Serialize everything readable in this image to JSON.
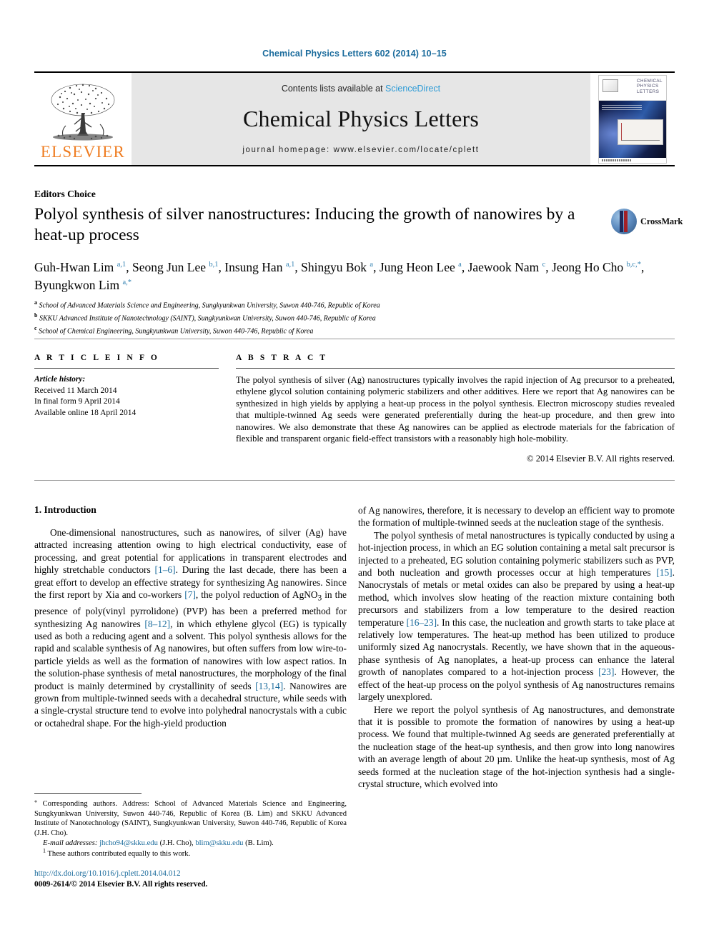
{
  "running_head": "Chemical Physics Letters 602 (2014) 10–15",
  "masthead": {
    "publisher_logo_text": "ELSEVIER",
    "contents_prefix": "Contents lists available at ",
    "sciencedirect": "ScienceDirect",
    "journal_title": "Chemical Physics Letters",
    "homepage_line": "journal homepage: www.elsevier.com/locate/cplett",
    "cover_title_lines": [
      "CHEMICAL",
      "PHYSICS",
      "LETTERS"
    ]
  },
  "article": {
    "category": "Editors Choice",
    "crossmark_label": "CrossMark",
    "title": "Polyol synthesis of silver nanostructures: Inducing the growth of nanowires by a heat-up process",
    "authors_html": "Guh-Hwan Lim <sup>a,1</sup>, Seong Jun Lee <sup>b,1</sup>, Insung Han <sup>a,1</sup>, Shingyu Bok <sup>a</sup>, Jung Heon Lee <sup>a</sup>, Jaewook Nam <sup>c</sup>, Jeong Ho Cho <sup>b,c,</sup><sup>*</sup>, Byungkwon Lim <sup>a,</sup><sup>*</sup>",
    "affiliations": [
      {
        "marker": "a",
        "text": "School of Advanced Materials Science and Engineering, Sungkyunkwan University, Suwon 440-746, Republic of Korea"
      },
      {
        "marker": "b",
        "text": "SKKU Advanced Institute of Nanotechnology (SAINT), Sungkyunkwan University, Suwon 440-746, Republic of Korea"
      },
      {
        "marker": "c",
        "text": "School of Chemical Engineering, Sungkyunkwan University, Suwon 440-746, Republic of Korea"
      }
    ]
  },
  "article_info": {
    "label": "A R T I C L E    I N F O",
    "history_label": "Article history:",
    "history": [
      "Received 11 March 2014",
      "In final form 9 April 2014",
      "Available online 18 April 2014"
    ]
  },
  "abstract": {
    "label": "A B S T R A C T",
    "text": "The polyol synthesis of silver (Ag) nanostructures typically involves the rapid injection of Ag precursor to a preheated, ethylene glycol solution containing polymeric stabilizers and other additives. Here we report that Ag nanowires can be synthesized in high yields by applying a heat-up process in the polyol synthesis. Electron microscopy studies revealed that multiple-twinned Ag seeds were generated preferentially during the heat-up procedure, and then grew into nanowires. We also demonstrate that these Ag nanowires can be applied as electrode materials for the fabrication of flexible and transparent organic field-effect transistors with a reasonably high hole-mobility.",
    "copyright": "© 2014 Elsevier B.V. All rights reserved."
  },
  "body": {
    "section_heading": "1. Introduction",
    "left_paragraphs_html": [
      "One-dimensional nanostructures, such as nanowires, of silver (Ag) have attracted increasing attention owing to high electrical conductivity, ease of processing, and great potential for applications in transparent electrodes and highly stretchable conductors <span class=\"ref\">[1–6]</span>. During the last decade, there has been a great effort to develop an effective strategy for synthesizing Ag nanowires. Since the first report by Xia and co-workers <span class=\"ref\">[7]</span>, the polyol reduction of AgNO<sub>3</sub> in the presence of poly(vinyl pyrrolidone) (PVP) has been a preferred method for synthesizing Ag nanowires <span class=\"ref\">[8–12]</span>, in which ethylene glycol (EG) is typically used as both a reducing agent and a solvent. This polyol synthesis allows for the rapid and scalable synthesis of Ag nanowires, but often suffers from low wire-to-particle yields as well as the formation of nanowires with low aspect ratios. In the solution-phase synthesis of metal nanostructures, the morphology of the final product is mainly determined by crystallinity of seeds <span class=\"ref\">[13,14]</span>. Nanowires are grown from multiple-twinned seeds with a decahedral structure, while seeds with a single-crystal structure tend to evolve into polyhedral nanocrystals with a cubic or octahedral shape. For the high-yield production"
    ],
    "right_paragraphs_html": [
      "of Ag nanowires, therefore, it is necessary to develop an efficient way to promote the formation of multiple-twinned seeds at the nucleation stage of the synthesis.",
      "The polyol synthesis of metal nanostructures is typically conducted by using a hot-injection process, in which an EG solution containing a metal salt precursor is injected to a preheated, EG solution containing polymeric stabilizers such as PVP, and both nucleation and growth processes occur at high temperatures <span class=\"ref\">[15]</span>. Nanocrystals of metals or metal oxides can also be prepared by using a heat-up method, which involves slow heating of the reaction mixture containing both precursors and stabilizers from a low temperature to the desired reaction temperature <span class=\"ref\">[16–23]</span>. In this case, the nucleation and growth starts to take place at relatively low temperatures. The heat-up method has been utilized to produce uniformly sized Ag nanocrystals. Recently, we have shown that in the aqueous-phase synthesis of Ag nanoplates, a heat-up process can enhance the lateral growth of nanoplates compared to a hot-injection process <span class=\"ref\">[23]</span>. However, the effect of the heat-up process on the polyol synthesis of Ag nanostructures remains largely unexplored.",
      "Here we report the polyol synthesis of Ag nanostructures, and demonstrate that it is possible to promote the formation of nanowires by using a heat-up process. We found that multiple-twinned Ag seeds are generated preferentially at the nucleation stage of the heat-up synthesis, and then grow into long nanowires with an average length of about 20 µm. Unlike the heat-up synthesis, most of Ag seeds formed at the nucleation stage of the hot-injection synthesis had a single-crystal structure, which evolved into"
    ]
  },
  "footnotes": {
    "corresponding_html": "<span class=\"fn-sup\">⁎</span> Corresponding authors. Address: School of Advanced Materials Science and Engineering, Sungkyunkwan University, Suwon 440-746, Republic of Korea (B. Lim) and SKKU Advanced Institute of Nanotechnology (SAINT), Sungkyunkwan University, Suwon 440-746, Republic of Korea (J.H. Cho).",
    "email_label": "E-mail addresses:",
    "email_1": "jhcho94@skku.edu",
    "email_1_owner": "(J.H. Cho),",
    "email_2": "blim@skku.edu",
    "email_2_owner": "(B. Lim).",
    "equal_contribution_html": "<span class=\"fn-sup\">1</span> These authors contributed equally to this work."
  },
  "footer": {
    "doi": "http://dx.doi.org/10.1016/j.cplett.2014.04.012",
    "issn_line": "0009-2614/© 2014 Elsevier B.V. All rights reserved."
  },
  "colors": {
    "link_blue": "#1a6b9c",
    "sciencedirect_blue": "#2b9ad6",
    "elsevier_orange": "#ef7d22",
    "masthead_gray": "#e6e6e6"
  }
}
